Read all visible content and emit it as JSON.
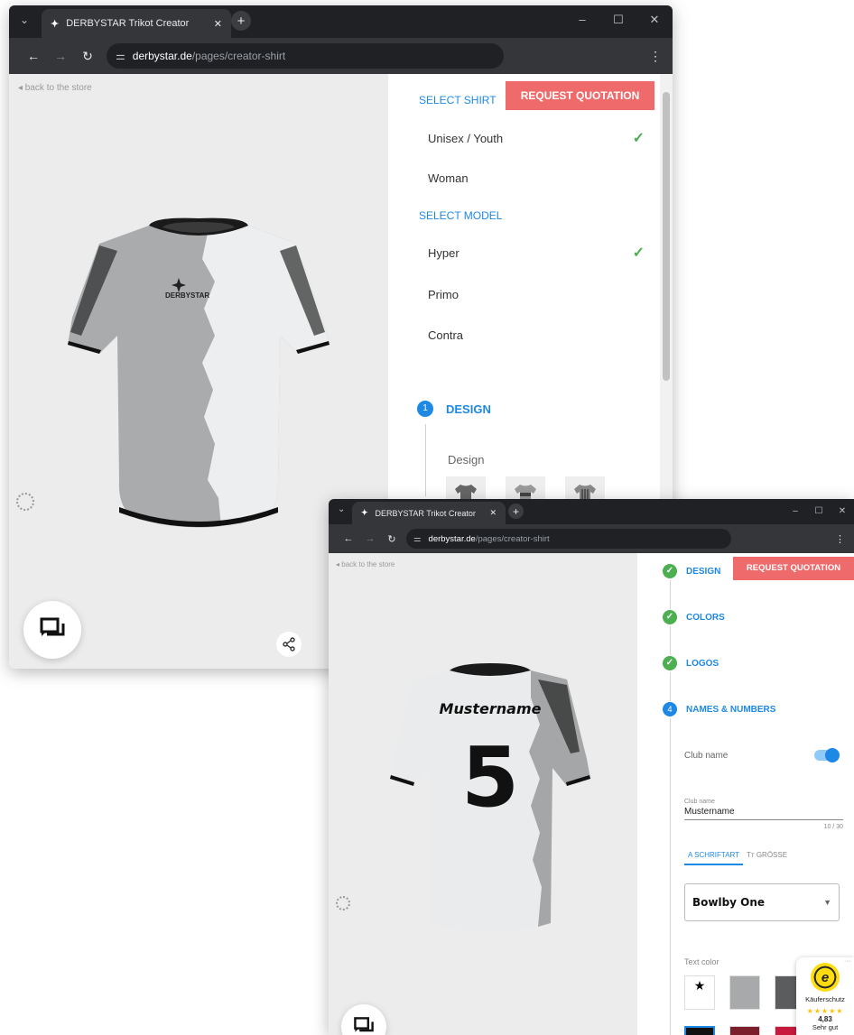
{
  "back_window": {
    "tab_title": "DERBYSTAR Trikot Creator",
    "url_host": "derbystar.de",
    "url_path": "/pages/creator-shirt",
    "back_link": "◂ back to the store",
    "request_quotation": "REQUEST QUOTATION",
    "select_shirt_heading": "SELECT SHIRT",
    "shirt_options": [
      {
        "label": "Unisex / Youth",
        "selected": true
      },
      {
        "label": "Woman",
        "selected": false
      }
    ],
    "select_model_heading": "SELECT MODEL",
    "model_options": [
      {
        "label": "Hyper",
        "selected": true
      },
      {
        "label": "Primo",
        "selected": false
      },
      {
        "label": "Contra",
        "selected": false
      }
    ],
    "step_number": "1",
    "step_label": "DESIGN",
    "design_label": "Design",
    "shirt_brand_text": "DERBYSTAR"
  },
  "front_window": {
    "tab_title": "DERBYSTAR Trikot Creator",
    "url_host": "derbystar.de",
    "url_path": "/pages/creator-shirt",
    "back_link": "◂ back to the store",
    "request_quotation": "REQUEST QUOTATION",
    "steps": [
      {
        "label": "DESIGN",
        "status": "done"
      },
      {
        "label": "COLORS",
        "status": "done"
      },
      {
        "label": "LOGOS",
        "status": "done"
      },
      {
        "label": "NAMES & NUMBERS",
        "status": "active",
        "number": "4"
      }
    ],
    "club_name_toggle_label": "Club name",
    "club_name_toggle_on": true,
    "club_name_field_label": "Club name",
    "club_name_value": "Mustername",
    "club_name_counter": "10 / 30",
    "tab_font": "A SCHRIFTART",
    "tab_size": "Tт GRÖSSE",
    "font_selected": "Bowlby One",
    "text_color_label": "Text color",
    "shirt_name": "Mustername",
    "shirt_number": "5",
    "swatch_colors_row1": [
      "#ffffff",
      "#a7a9aa",
      "#5a5c5e"
    ],
    "swatch_colors_row2": [
      "#111111",
      "#7a1f2b",
      "#c8193c"
    ]
  },
  "trust_badge": {
    "title": "Käuferschutz",
    "stars": "★★★★★",
    "rating": "4,83",
    "grade": "Sehr gut"
  },
  "colors": {
    "accent": "#1e88e5",
    "quotation": "#ef6b6b",
    "check": "#4caf50",
    "chrome_dark": "#202124"
  }
}
